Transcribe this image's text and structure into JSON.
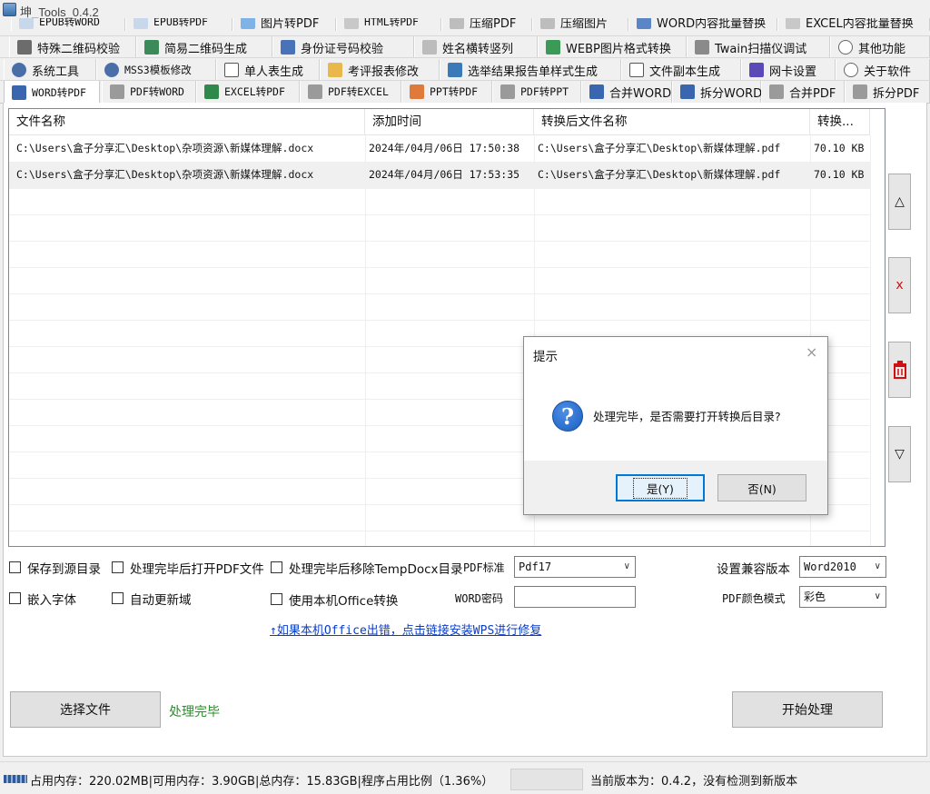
{
  "window": {
    "title": "坤_Tools_0.4.2"
  },
  "tabs": {
    "row0": [
      "EPUB转WORD",
      "EPUB转PDF",
      "图片转PDF",
      "HTML转PDF",
      "压缩PDF",
      "压缩图片",
      "WORD内容批量替换",
      "EXCEL内容批量替换"
    ],
    "row1": [
      "特殊二维码校验",
      "简易二维码生成",
      "身份证号码校验",
      "姓名横转竖列",
      "WEBP图片格式转换",
      "Twain扫描仪调试",
      "其他功能"
    ],
    "row2": [
      "系统工具",
      "MSS3模板修改",
      "单人表生成",
      "考评报表修改",
      "选举结果报告单样式生成",
      "文件副本生成",
      "网卡设置",
      "关于软件"
    ],
    "row3": [
      "WORD转PDF",
      "PDF转WORD",
      "EXCEL转PDF",
      "PDF转EXCEL",
      "PPT转PDF",
      "PDF转PPT",
      "合并WORD",
      "拆分WORD",
      "合并PDF",
      "拆分PDF"
    ]
  },
  "file_list": {
    "columns": [
      "文件名称",
      "添加时间",
      "转换后文件名称",
      "转换..."
    ],
    "rows": [
      [
        "C:\\Users\\盒子分享汇\\Desktop\\杂项资源\\新媒体理解.docx",
        "2024年/04月/06日 17:50:38",
        "C:\\Users\\盒子分享汇\\Desktop\\新媒体理解.pdf",
        "70.10 KB"
      ],
      [
        "C:\\Users\\盒子分享汇\\Desktop\\杂项资源\\新媒体理解.docx",
        "2024年/04月/06日 17:53:35",
        "C:\\Users\\盒子分享汇\\Desktop\\新媒体理解.pdf",
        "70.10 KB"
      ]
    ]
  },
  "side_buttons": {
    "up": "△",
    "remove": "x",
    "down": "▽"
  },
  "dialog": {
    "title": "提示",
    "close": "×",
    "icon": "?",
    "message": "处理完毕，是否需要打开转换后目录?",
    "yes": "是(Y)",
    "no": "否(N)"
  },
  "options": {
    "save_to_source": "保存到源目录",
    "open_pdf_after": "处理完毕后打开PDF文件",
    "remove_temp": "处理完毕后移除TempDocx目录",
    "pdf_standard_label": "PDF标准",
    "pdf_standard_value": "Pdf17",
    "compat_label": "设置兼容版本",
    "compat_value": "Word2010",
    "embed_fonts": "嵌入字体",
    "auto_update": "自动更新域",
    "use_office": "使用本机Office转换",
    "word_password_label": "WORD密码",
    "word_password_value": "",
    "pdf_color_label": "PDF颜色模式",
    "pdf_color_value": "彩色",
    "repair_link": "↑如果本机Office出错，点击链接安装WPS进行修复"
  },
  "actions": {
    "select_file": "选择文件",
    "status": "处理完毕",
    "start": "开始处理"
  },
  "statusbar": {
    "memory": "占用内存：220.02MB|可用内存：3.90GB|总内存：15.83GB|程序占用比例（1.36%）",
    "version": "当前版本为：0.4.2，没有检测到新版本"
  },
  "colors": {
    "accent": "#0078d7",
    "link": "#0a3cc8",
    "status_ok": "#2c8c2c",
    "selected_row": "#f0f0f0"
  }
}
